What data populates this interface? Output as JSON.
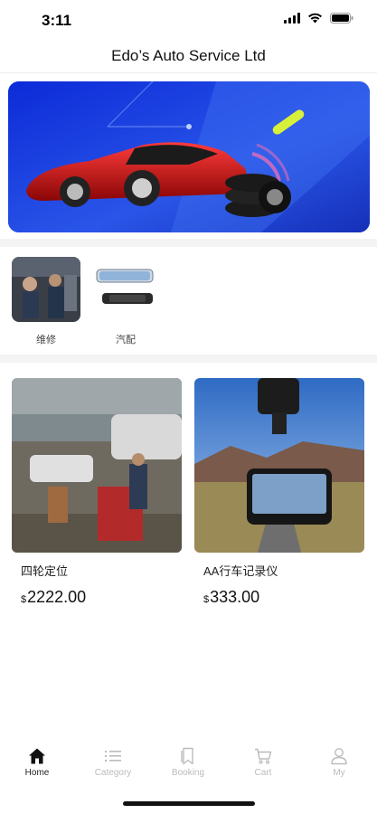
{
  "status": {
    "time": "3:11"
  },
  "header": {
    "title": "Edo’s Auto Service Ltd"
  },
  "categories": [
    {
      "label": "维修"
    },
    {
      "label": "汽配"
    }
  ],
  "products": [
    {
      "name": "四轮定位",
      "currency": "$",
      "price": "2222.00"
    },
    {
      "name": "AA行车记录仪",
      "currency": "$",
      "price": "333.00"
    }
  ],
  "tabs": [
    {
      "label": "Home",
      "icon": "home-icon",
      "active": true
    },
    {
      "label": "Category",
      "icon": "list-icon",
      "active": false
    },
    {
      "label": "Booking",
      "icon": "bookmark-icon",
      "active": false
    },
    {
      "label": "Cart",
      "icon": "cart-icon",
      "active": false
    },
    {
      "label": "My",
      "icon": "user-icon",
      "active": false
    }
  ],
  "colors": {
    "banner": "#1a35c9",
    "active_tab": "#222222",
    "inactive_tab": "#bbbbbb"
  }
}
